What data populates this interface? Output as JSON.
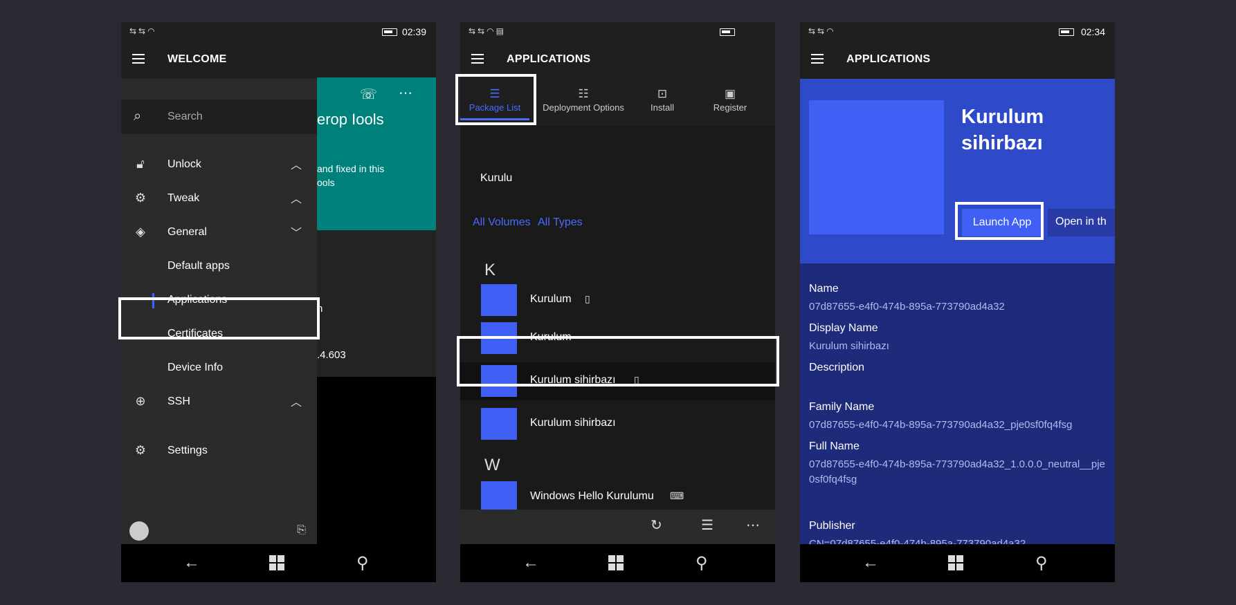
{
  "phone1": {
    "status": {
      "time": "02:39"
    },
    "title": "WELCOME",
    "background": {
      "teal_text": "erop  Iools",
      "teal_sub1": "and fixed in this",
      "teal_sub2": "ools",
      "mid_text1": "n",
      "mid_text2": ".4.603"
    },
    "menu": {
      "search_placeholder": "Search",
      "items": [
        {
          "label": "Unlock",
          "icon": "lock-icon",
          "chevron": "up"
        },
        {
          "label": "Tweak",
          "icon": "gear-icon",
          "chevron": "up"
        },
        {
          "label": "General",
          "icon": "layers-icon",
          "chevron": "down"
        },
        {
          "label": "Default apps"
        },
        {
          "label": "Applications",
          "selected": true
        },
        {
          "label": "Certificates"
        },
        {
          "label": "Device Info"
        },
        {
          "label": "SSH",
          "icon": "globe-icon",
          "chevron": "up"
        },
        {
          "label": "Settings",
          "icon": "gear-icon"
        }
      ]
    }
  },
  "phone2": {
    "title": "APPLICATIONS",
    "tabs": [
      {
        "label": "Package List",
        "icon": "list-icon",
        "active": true
      },
      {
        "label": "Deployment Options",
        "icon": "options-icon"
      },
      {
        "label": "Install",
        "icon": "install-icon"
      },
      {
        "label": "Register",
        "icon": "register-icon"
      }
    ],
    "search_value": "Kurulu",
    "filters": {
      "volumes": "All Volumes",
      "types": "All Types"
    },
    "groups": [
      {
        "letter": "K",
        "items": [
          {
            "name": "Kurulum",
            "device": "phone"
          },
          {
            "name": "Kurulum"
          },
          {
            "name": "Kurulum sihirbazı",
            "device": "phone",
            "selected": true
          },
          {
            "name": "Kurulum sihirbazı"
          }
        ]
      },
      {
        "letter": "W",
        "items": [
          {
            "name": "Windows Hello Kurulumu",
            "device": "keyboard"
          }
        ]
      }
    ]
  },
  "phone3": {
    "status": {
      "time": "02:34"
    },
    "title": "APPLICATIONS",
    "app_name": "Kurulum sihirbazı",
    "launch_label": "Launch App",
    "open_label": "Open in th",
    "details": [
      {
        "key": "Name",
        "value": "07d87655-e4f0-474b-895a-773790ad4a32"
      },
      {
        "key": "Display Name",
        "value": "Kurulum sihirbazı"
      },
      {
        "key": "Description",
        "value": ""
      },
      {
        "key": "Family Name",
        "value": "07d87655-e4f0-474b-895a-773790ad4a32_pje0sf0fq4fsg"
      },
      {
        "key": "Full Name",
        "value": "07d87655-e4f0-474b-895a-773790ad4a32_1.0.0.0_neutral__pje0sf0fq4fsg"
      },
      {
        "key": "Publisher",
        "value": "CN=07d87655-e4f0-474b-895a-773790ad4a32"
      }
    ]
  },
  "colors": {
    "accent": "#4a6bff",
    "tile": "#3f5ff5",
    "teal": "#00807a",
    "detail_bg": "#1e2a7a"
  }
}
